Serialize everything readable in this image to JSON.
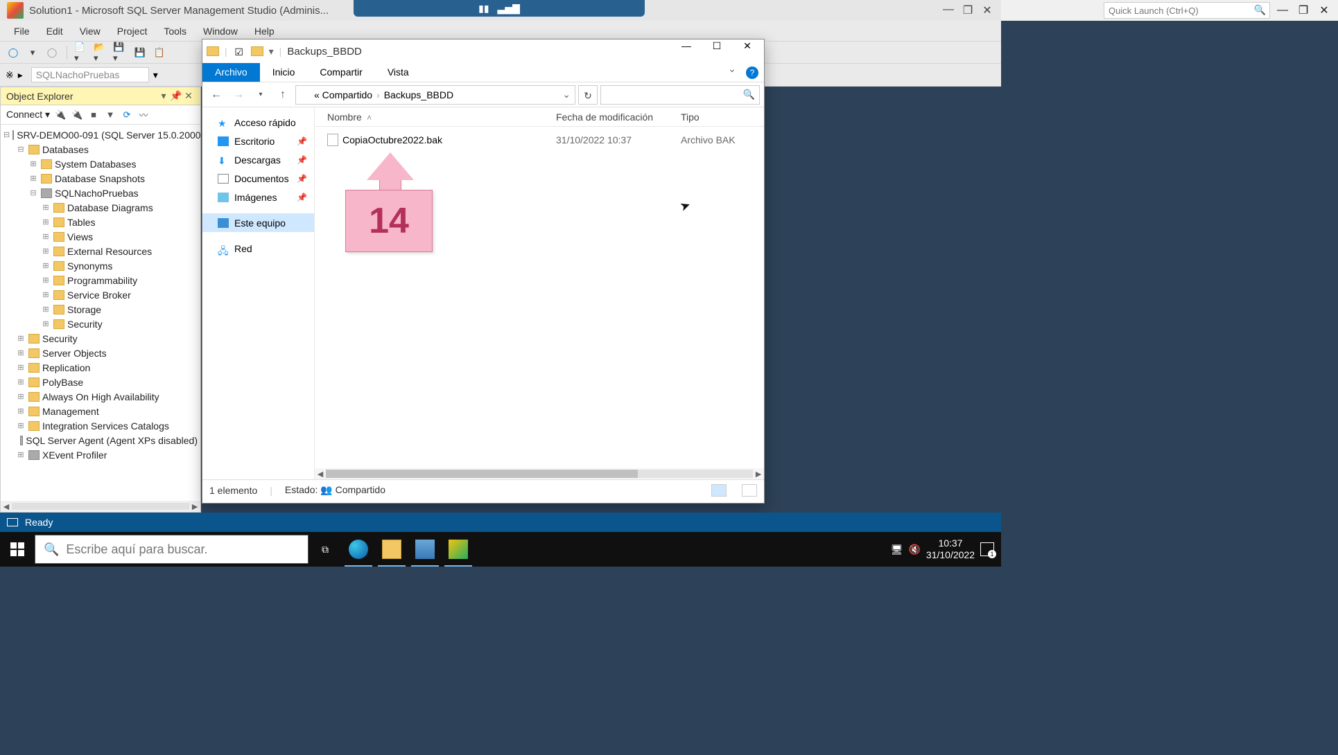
{
  "ssms": {
    "title": "Solution1 - Microsoft SQL Server Management Studio (Adminis...",
    "menu": [
      "File",
      "Edit",
      "View",
      "Project",
      "Tools",
      "Window",
      "Help"
    ],
    "quick_launch_placeholder": "Quick Launch (Ctrl+Q)",
    "db_selector": "SQLNachoPruebas"
  },
  "object_explorer": {
    "title": "Object Explorer",
    "connect": "Connect ▾",
    "server": "SRV-DEMO00-091 (SQL Server 15.0.2000",
    "nodes": [
      {
        "indent": 1,
        "exp": "⊟",
        "icon": "f",
        "label": "Databases"
      },
      {
        "indent": 2,
        "exp": "⊞",
        "icon": "f",
        "label": "System Databases"
      },
      {
        "indent": 2,
        "exp": "⊞",
        "icon": "f",
        "label": "Database Snapshots"
      },
      {
        "indent": 2,
        "exp": "⊟",
        "icon": "s",
        "label": "SQLNachoPruebas"
      },
      {
        "indent": 3,
        "exp": "⊞",
        "icon": "f",
        "label": "Database Diagrams"
      },
      {
        "indent": 3,
        "exp": "⊞",
        "icon": "f",
        "label": "Tables"
      },
      {
        "indent": 3,
        "exp": "⊞",
        "icon": "f",
        "label": "Views"
      },
      {
        "indent": 3,
        "exp": "⊞",
        "icon": "f",
        "label": "External Resources"
      },
      {
        "indent": 3,
        "exp": "⊞",
        "icon": "f",
        "label": "Synonyms"
      },
      {
        "indent": 3,
        "exp": "⊞",
        "icon": "f",
        "label": "Programmability"
      },
      {
        "indent": 3,
        "exp": "⊞",
        "icon": "f",
        "label": "Service Broker"
      },
      {
        "indent": 3,
        "exp": "⊞",
        "icon": "f",
        "label": "Storage"
      },
      {
        "indent": 3,
        "exp": "⊞",
        "icon": "f",
        "label": "Security"
      },
      {
        "indent": 1,
        "exp": "⊞",
        "icon": "f",
        "label": "Security"
      },
      {
        "indent": 1,
        "exp": "⊞",
        "icon": "f",
        "label": "Server Objects"
      },
      {
        "indent": 1,
        "exp": "⊞",
        "icon": "f",
        "label": "Replication"
      },
      {
        "indent": 1,
        "exp": "⊞",
        "icon": "f",
        "label": "PolyBase"
      },
      {
        "indent": 1,
        "exp": "⊞",
        "icon": "f",
        "label": "Always On High Availability"
      },
      {
        "indent": 1,
        "exp": "⊞",
        "icon": "f",
        "label": "Management"
      },
      {
        "indent": 1,
        "exp": "⊞",
        "icon": "f",
        "label": "Integration Services Catalogs"
      },
      {
        "indent": 1,
        "exp": "",
        "icon": "s",
        "label": "SQL Server Agent (Agent XPs disabled)"
      },
      {
        "indent": 1,
        "exp": "⊞",
        "icon": "s",
        "label": "XEvent Profiler"
      }
    ]
  },
  "explorer": {
    "window_title": "Backups_BBDD",
    "ribbon": {
      "file": "Archivo",
      "home": "Inicio",
      "share": "Compartir",
      "view": "Vista"
    },
    "breadcrumb": {
      "root": "«  Compartido",
      "leaf": "Backups_BBDD"
    },
    "sidebar": [
      {
        "label": "Acceso rápido",
        "cls": "star",
        "pin": false
      },
      {
        "label": "Escritorio",
        "cls": "desktop",
        "pin": true
      },
      {
        "label": "Descargas",
        "cls": "down",
        "pin": true
      },
      {
        "label": "Documentos",
        "cls": "doc",
        "pin": true
      },
      {
        "label": "Imágenes",
        "cls": "img",
        "pin": true
      },
      {
        "label": "Este equipo",
        "cls": "pc",
        "pin": false,
        "sel": true
      },
      {
        "label": "Red",
        "cls": "net",
        "pin": false
      }
    ],
    "columns": {
      "name": "Nombre",
      "date": "Fecha de modificación",
      "type": "Tipo"
    },
    "files": [
      {
        "name": "CopiaOctubre2022.bak",
        "date": "31/10/2022 10:37",
        "type": "Archivo BAK"
      }
    ],
    "status": {
      "count": "1 elemento",
      "state": "Estado:",
      "shared": "Compartido"
    }
  },
  "callout_number": "14",
  "statusbar": {
    "text": "Ready"
  },
  "taskbar": {
    "search_placeholder": "Escribe aquí para buscar.",
    "time": "10:37",
    "date": "31/10/2022"
  }
}
